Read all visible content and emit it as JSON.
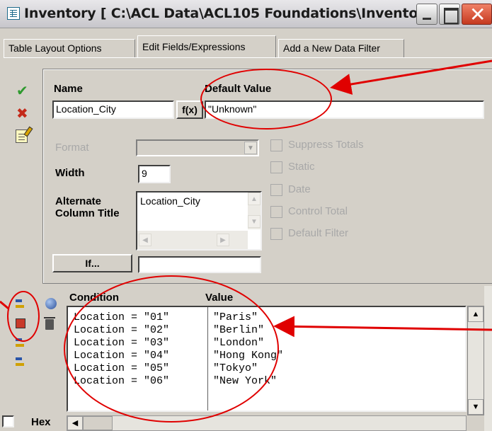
{
  "window": {
    "title": "Inventory [ C:\\ACL Data\\ACL105 Foundations\\Inventor..."
  },
  "tabs": [
    {
      "label": "Table Layout Options"
    },
    {
      "label": "Edit Fields/Expressions"
    },
    {
      "label": "Add a New Data Filter"
    }
  ],
  "field": {
    "name_label": "Name",
    "name_value": "Location_City",
    "fx_label": "f(x)",
    "default_label": "Default Value",
    "default_value": "\"Unknown\"",
    "format_label": "Format",
    "width_label": "Width",
    "width_value": "9",
    "alt_label": "Alternate Column Title",
    "alt_value": "Location_City",
    "if_label": "If...",
    "if_value": ""
  },
  "options": [
    {
      "label": "Suppress Totals",
      "checked": false
    },
    {
      "label": "Static",
      "checked": false
    },
    {
      "label": "Date",
      "checked": false
    },
    {
      "label": "Control Total",
      "checked": false
    },
    {
      "label": "Default Filter",
      "checked": false
    }
  ],
  "cases": {
    "condition_header": "Condition",
    "value_header": "Value",
    "rows": [
      {
        "condition": "Location = \"01\"",
        "value": "\"Paris\""
      },
      {
        "condition": "Location = \"02\"",
        "value": "\"Berlin\""
      },
      {
        "condition": "Location = \"03\"",
        "value": "\"London\""
      },
      {
        "condition": "Location = \"04\"",
        "value": "\"Hong Kong\""
      },
      {
        "condition": "Location = \"05\"",
        "value": "\"Tokyo\""
      },
      {
        "condition": "Location = \"06\"",
        "value": "\"New York\""
      }
    ]
  },
  "hex": {
    "label": "Hex",
    "checked": false
  },
  "colors": {
    "annotation": "#e00000",
    "window_bg": "#d4d0c8"
  }
}
